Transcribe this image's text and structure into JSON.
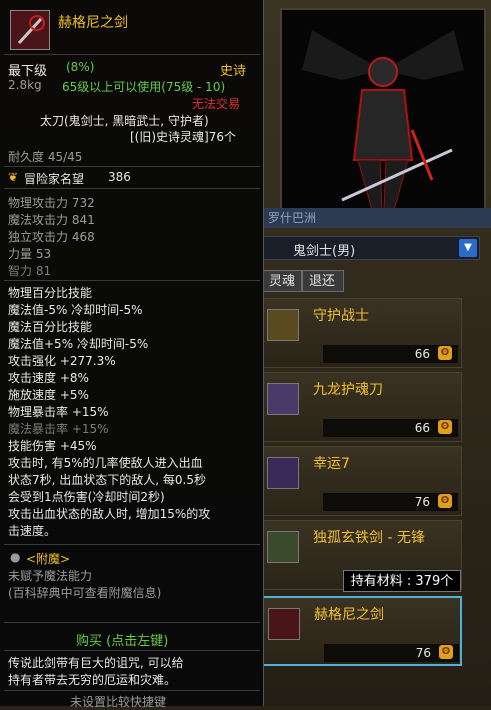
{
  "tooltip": {
    "item_name": "赫格尼之剑",
    "grade": "最下级",
    "grade_pct": "(8%)",
    "rarity": "史诗",
    "weight": "2.8kg",
    "level_req": "65级以上可以使用(75级 - 10)",
    "trade": "无法交易",
    "class_line": "太刀(鬼剑士, 黑暗武士, 守护者)",
    "soul_line": "[(旧)史诗灵魂]76个",
    "durability": "耐久度 45/45",
    "fame_label": "冒险家名望",
    "fame_value": "386",
    "stats": [
      "物理攻击力 732",
      "魔法攻击力 841",
      "独立攻击力 468",
      "力量 53",
      "智力 81"
    ],
    "skills": [
      {
        "text": "物理百分比技能",
        "cls": "white"
      },
      {
        "text": " 魔法值-5% 冷却时间-5%",
        "cls": "white"
      },
      {
        "text": "魔法百分比技能",
        "cls": "white"
      },
      {
        "text": " 魔法值+5% 冷却时间-5%",
        "cls": "white"
      },
      {
        "text": "攻击强化 +277.3%",
        "cls": "white"
      },
      {
        "text": "攻击速度 +8%",
        "cls": "white"
      },
      {
        "text": "施放速度 +5%",
        "cls": "white"
      },
      {
        "text": "物理暴击率 +15%",
        "cls": "white"
      },
      {
        "text": "魔法暴击率 +15%",
        "cls": "dim"
      },
      {
        "text": "技能伤害 +45%",
        "cls": "white"
      },
      {
        "text": "攻击时, 有5%的几率使敌人进入出血",
        "cls": "white"
      },
      {
        "text": "状态7秒, 出血状态下的敌人, 每0.5秒",
        "cls": "white"
      },
      {
        "text": "会受到1点伤害(冷却时间2秒)",
        "cls": "white"
      },
      {
        "text": "攻击出血状态的敌人时, 增加15%的攻",
        "cls": "white"
      },
      {
        "text": "击速度。",
        "cls": "white"
      }
    ],
    "enchant_title": "<附魔>",
    "enchant_none": "未赋予魔法能力",
    "enchant_hint": "(百科辞典中可查看附魔信息)",
    "buy": "购买 (点击左键)",
    "lore1": "传说此剑带有巨大的诅咒, 可以给",
    "lore2": "持有者带去无穷的厄运和灾难。",
    "bottom": "未设置比较快捷键"
  },
  "shop": {
    "title": "罗什巴洲",
    "class_select": "鬼剑士(男)",
    "tabs": [
      "灵魂",
      "退还"
    ],
    "items": [
      {
        "name": "守护战士",
        "price": "66"
      },
      {
        "name": "九龙护魂刀",
        "price": "66"
      },
      {
        "name": "幸运7",
        "price": "76"
      },
      {
        "name": "独孤玄铁剑 - 无锋",
        "price": ""
      },
      {
        "name": "赫格尼之剑",
        "price": "76"
      }
    ],
    "material_tip": "持有材料 : 379个",
    "coin_glyph": "ʘ"
  },
  "colors": {
    "rarity": "#f0c020",
    "selected_border": "#4fb0d8",
    "trade_red": "#e03030"
  }
}
